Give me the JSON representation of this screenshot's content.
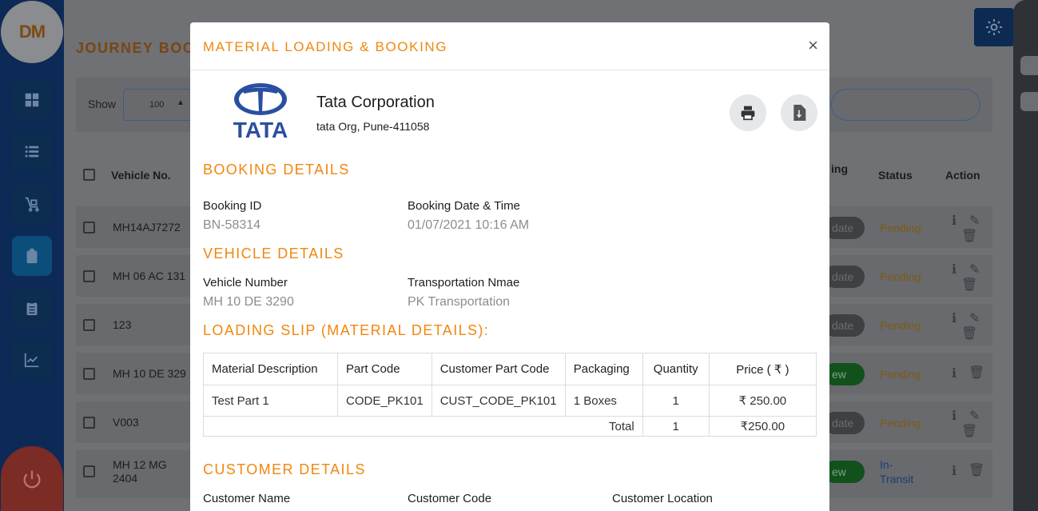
{
  "app": {
    "logo_text": "DM",
    "page_title": "JOURNEY BOOK",
    "show_label": "Show",
    "show_value": "100",
    "table_headers": {
      "vehicle_no": "Vehicle No.",
      "ing": "ing",
      "status": "Status",
      "action": "Action"
    },
    "rows": [
      {
        "vehicle": "MH14AJ7272",
        "button": "date",
        "status": "Pending"
      },
      {
        "vehicle": "MH 06 AC 131",
        "button": "date",
        "status": "Pending"
      },
      {
        "vehicle": "123",
        "button": "date",
        "status": "Pending"
      },
      {
        "vehicle": "MH 10 DE 329",
        "button": "ew",
        "status": "Pending"
      },
      {
        "vehicle": "V003",
        "button": "date",
        "status": "Pending"
      },
      {
        "vehicle": "MH 12 MG\n2404",
        "button": "ew",
        "status": "In-\nTransit"
      }
    ]
  },
  "modal": {
    "title": "MATERIAL LOADING & BOOKING",
    "close_label": "×",
    "company": {
      "logo_word": "TATA",
      "name": "Tata Corporation",
      "address": "tata Org, Pune-411058"
    },
    "booking": {
      "section_title": "BOOKING DETAILS",
      "id_label": "Booking ID",
      "id_value": "BN-58314",
      "date_label": "Booking Date & Time",
      "date_value": "01/07/2021 10:16 AM"
    },
    "vehicle": {
      "section_title": "VEHICLE DETAILS",
      "number_label": "Vehicle Number",
      "number_value": "MH 10 DE 3290",
      "transport_label": "Transportation Nmae",
      "transport_value": "PK Transportation"
    },
    "loading": {
      "section_title": "LOADING SLIP (MATERIAL DETAILS):",
      "headers": [
        "Material Description",
        "Part Code",
        "Customer Part Code",
        "Packaging",
        "Quantity",
        "Price ( ₹ )"
      ],
      "rows": [
        [
          "Test Part 1",
          "CODE_PK101",
          "CUST_CODE_PK101",
          "1 Boxes",
          "1",
          "₹ 250.00"
        ]
      ],
      "total_label": "Total",
      "total_qty": "1",
      "total_price": "₹250.00"
    },
    "customer": {
      "section_title": "CUSTOMER DETAILS",
      "name_label": "Customer Name",
      "code_label": "Customer Code",
      "location_label": "Customer Location"
    }
  }
}
